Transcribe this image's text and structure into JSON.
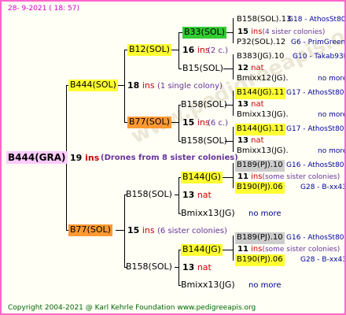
{
  "timestamp": "28-  9-2021  ( 18:  57)",
  "footer": "Copyright 2004-2021 @ Karl Kehrle Foundation    www.pedigreeapis.org",
  "colors": {
    "border": "#ff66cc",
    "yellow": "#ffff33",
    "orange": "#ff9933",
    "green": "#33cc33",
    "pink": "#ffccff",
    "gray": "#cccccc",
    "red": "#cc0000",
    "blue": "#000099"
  },
  "root": {
    "name": "B444(GRA)",
    "gen": "19",
    "ins": "ins",
    "note": "(Drones from 8 sister colonies)"
  },
  "g1": {
    "upper": {
      "name": "B444(SOL)",
      "gen": "18",
      "ins": "ins",
      "note": "(1 single colony)"
    },
    "lower": {
      "name": "B77(SOL)",
      "gen": "15",
      "ins": "ins",
      "note": "(6 sister colonies)"
    }
  },
  "g2": {
    "a": {
      "name": "B12(SOL)",
      "gen": "16",
      "ins": "ins",
      "note": "(2 c.)"
    },
    "b": {
      "name": "B77(SOL)",
      "gen": "15",
      "ins": "ins",
      "note": "(6 c.)"
    },
    "c": {
      "name": "B158(SOL)",
      "gen": "13",
      "nat": "nat"
    },
    "d": {
      "name": "B158(SOL)",
      "gen": "13",
      "nat": "nat"
    }
  },
  "g3": {
    "a1": {
      "name": "B33(SOL)"
    },
    "a2": {
      "name": "B15(SOL)"
    },
    "b1": {
      "name": "B158(SOL)"
    },
    "b2": {
      "name": "B158(SOL)"
    },
    "c1": {
      "name": "B144(JG)"
    },
    "c2": {
      "name": "Bmixx13(JG)",
      "no_more": "no more"
    },
    "d1": {
      "name": "B144(JG)"
    },
    "d2": {
      "name": "Bmixx13(JG)",
      "no_more": "no more"
    }
  },
  "g4": [
    {
      "name": "B158(SOL).13",
      "info": "G18 - AthosSt80R"
    },
    {
      "gen": "15",
      "ins": "ins",
      "note": "(4 sister colonies)"
    },
    {
      "name": "P32(SOL).12",
      "info": "G6 - PrimGreen00"
    },
    {
      "name": "B383(JG).10",
      "info": "G10 - Takab93R"
    },
    {
      "gen": "12",
      "nat": "nat"
    },
    {
      "name": "Bmixx12(JG).",
      "info": "no more"
    },
    {
      "name": "B144(JG).11",
      "info": "G17 - AthosSt80R"
    },
    {
      "gen": "13",
      "nat": "nat"
    },
    {
      "name": "Bmixx13(JG).",
      "info": "no more"
    },
    {
      "name": "B144(JG).11",
      "info": "G17 - AthosSt80R"
    },
    {
      "gen": "13",
      "nat": "nat"
    },
    {
      "name": "Bmixx13(JG).",
      "info": "no more"
    },
    {
      "name": "B189(PJ).10",
      "info": "G16 - AthosSt80R"
    },
    {
      "gen": "11",
      "ins": "ins",
      "note": "(some sister colonies)"
    },
    {
      "name": "B190(PJ).06",
      "info": "G28 - B-xx43"
    },
    {
      "name": "B189(PJ).10",
      "info": "G16 - AthosSt80R"
    },
    {
      "gen": "11",
      "ins": "ins",
      "note": "(some sister colonies)"
    },
    {
      "name": "B190(PJ).06",
      "info": "G28 - B-xx43"
    }
  ]
}
